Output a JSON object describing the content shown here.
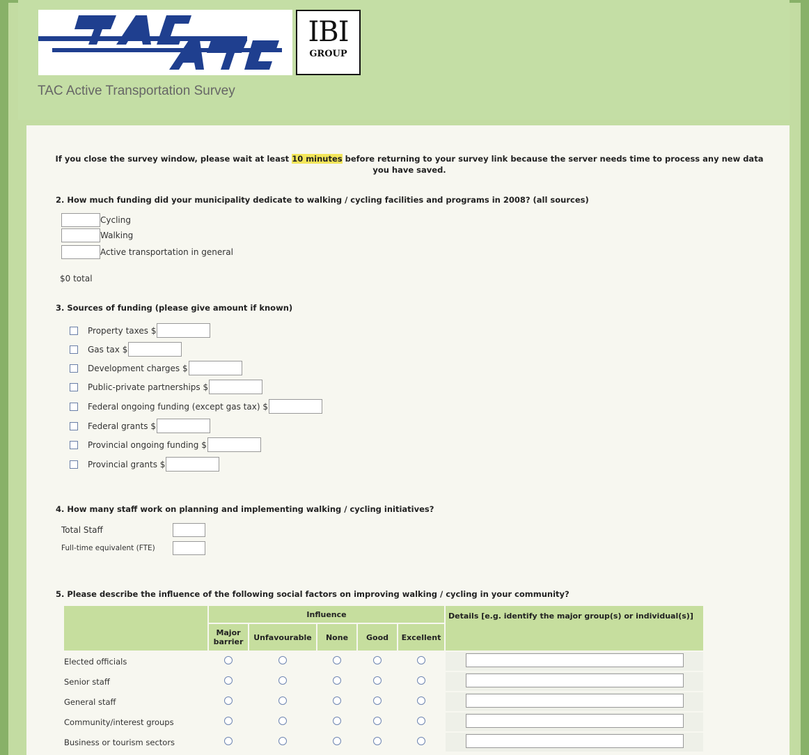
{
  "logo": {
    "ibi_top": "IBI",
    "ibi_bottom": "GROUP"
  },
  "header": {
    "title": "TAC Active Transportation Survey"
  },
  "notice": {
    "before": "If you close the survey window, please wait at least ",
    "highlight": "10 minutes",
    "after": " before returning to your survey link because the server needs time to process any new data you have saved."
  },
  "q2": {
    "question": "2. How much funding did your municipality dedicate to walking / cycling facilities and programs in 2008? (all sources)",
    "items": [
      "Cycling",
      "Walking",
      "Active transportation in general"
    ],
    "total": "$0 total"
  },
  "q3": {
    "question": "3. Sources of funding (please give amount if known)",
    "items": [
      "Property taxes $",
      "Gas tax $",
      "Development charges $",
      "Public-private partnerships $",
      "Federal ongoing funding (except gas tax) $",
      "Federal grants $",
      "Provincial ongoing funding $",
      "Provincial grants $"
    ]
  },
  "q4": {
    "question": "4. How many staff work on planning and implementing walking / cycling initiatives?",
    "items": [
      "Total Staff",
      "Full-time equivalent (FTE)"
    ]
  },
  "q5": {
    "question": "5. Please describe the influence of the following social factors on improving walking / cycling in your community?",
    "influence_header": "Influence",
    "details_header": "Details [e.g. identify the major group(s) or individual(s)]",
    "columns": [
      "Major barrier",
      "Unfavourable",
      "None",
      "Good",
      "Excellent"
    ],
    "rows": [
      "Elected officials",
      "Senior staff",
      "General staff",
      "Community/interest groups",
      "Business or tourism sectors"
    ]
  },
  "colors": {
    "accent_green": "#c4dea5",
    "highlight": "#f3e65a"
  }
}
